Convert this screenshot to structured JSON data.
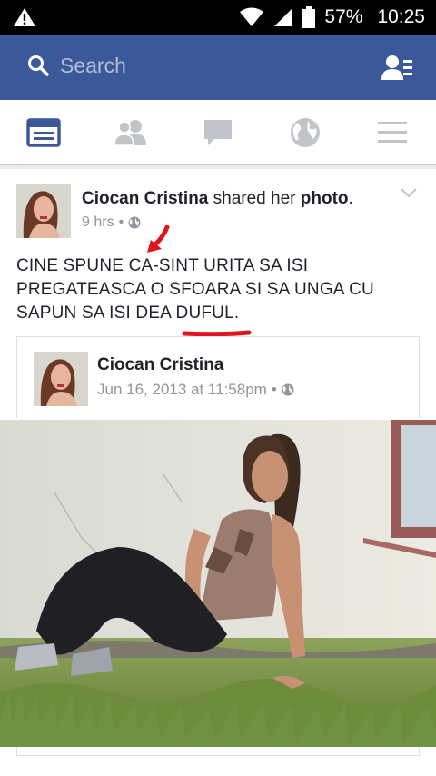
{
  "status_bar": {
    "battery": "57%",
    "time": "10:25",
    "icons": [
      "warning-icon",
      "wifi-icon",
      "signal-icon",
      "battery-icon"
    ]
  },
  "search": {
    "placeholder": "Search"
  },
  "nav": {
    "items": [
      "news-feed-icon",
      "friends-icon",
      "messages-icon",
      "globe-icon",
      "menu-icon"
    ]
  },
  "post": {
    "author": "Ciocan Cristina",
    "action_text": "shared her",
    "object": "photo",
    "punctuation": ".",
    "time": "9 hrs",
    "text": "CINE SPUNE CA-SINT URITA SA ISI PREGATEASCA O SFOARA SI SA UNGA CU SAPUN SA ISI DEA DUFUL.",
    "shared": {
      "author": "Ciocan Cristina",
      "time": "Jun 16, 2013 at 11:58pm"
    }
  },
  "colors": {
    "brand": "#3b5998",
    "annotation": "#e0141c"
  }
}
